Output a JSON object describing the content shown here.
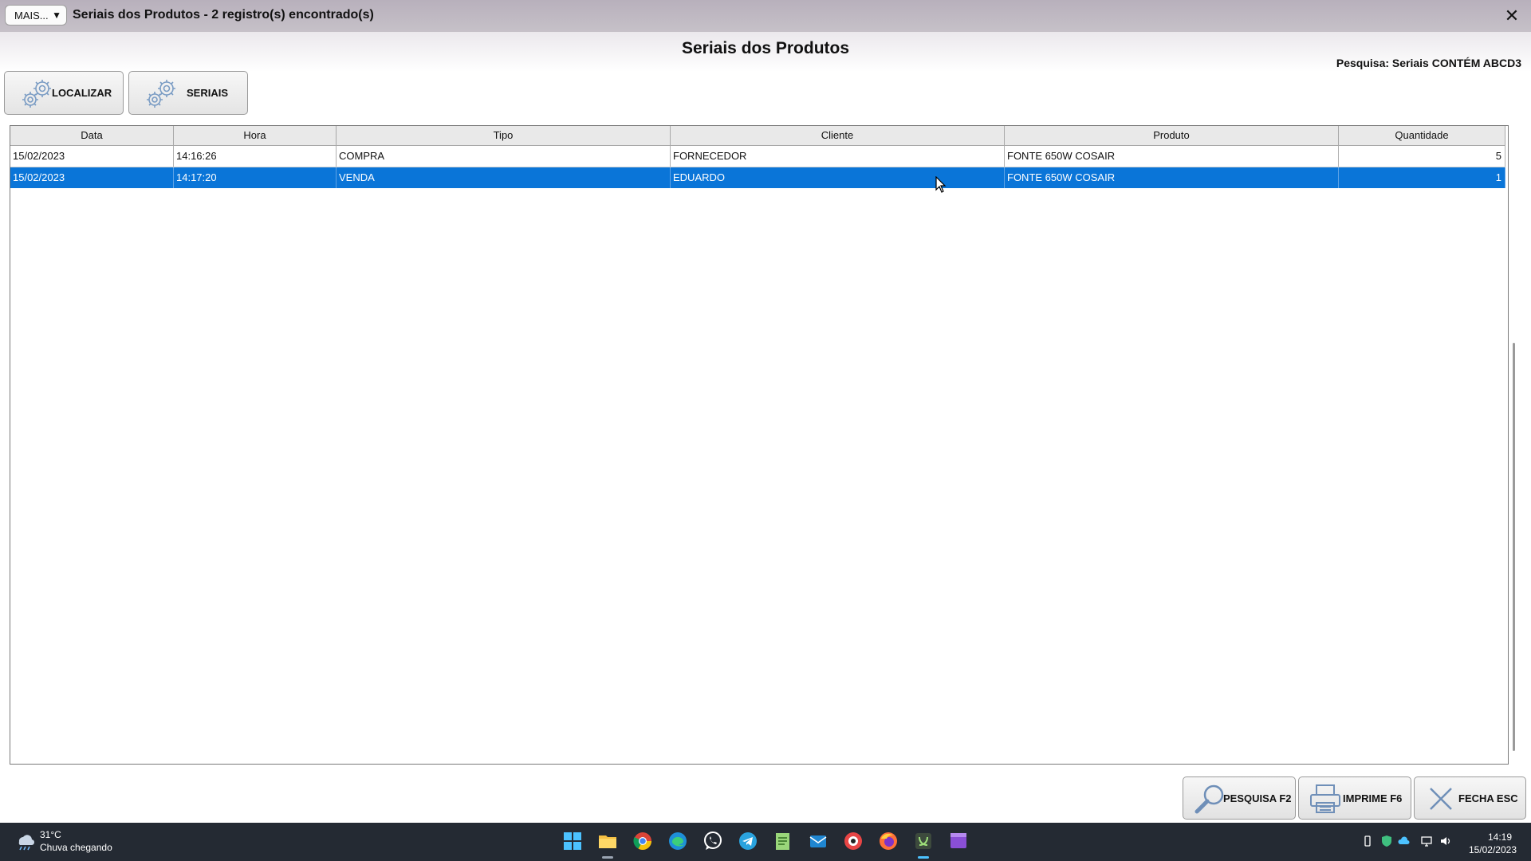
{
  "titlebar": {
    "menu_button": "MAIS...",
    "menu_arrow": "▼",
    "title": "Seriais dos Produtos - 2 registro(s) encontrado(s)",
    "close": "✕"
  },
  "header": {
    "title": "Seriais dos Produtos",
    "search_info": "Pesquisa: Seriais CONTÉM ABCD3"
  },
  "toolbar": {
    "localizar_label": "LOCALIZAR",
    "seriais_label": "SERIAIS"
  },
  "grid": {
    "columns": [
      "Data",
      "Hora",
      "Tipo",
      "Cliente",
      "Produto",
      "Quantidade"
    ],
    "rows": [
      {
        "data": "15/02/2023",
        "hora": "14:16:26",
        "tipo": "COMPRA",
        "cliente": "FORNECEDOR",
        "produto": "FONTE 650W COSAIR",
        "quantidade": "5",
        "selected": false
      },
      {
        "data": "15/02/2023",
        "hora": "14:17:20",
        "tipo": "VENDA",
        "cliente": "EDUARDO",
        "produto": "FONTE 650W COSAIR",
        "quantidade": "1",
        "selected": true
      }
    ],
    "selection_color": "#0a75d8"
  },
  "actions": {
    "pesquisa_label": "PESQUISA F2",
    "imprime_label": "IMPRIME F6",
    "fecha_label": "FECHA ESC"
  },
  "taskbar": {
    "weather_temp": "31°C",
    "weather_desc": "Chuva chegando",
    "apps": [
      "windows-start-icon",
      "file-explorer-icon",
      "chrome-icon",
      "edge-icon",
      "whatsapp-icon",
      "telegram-icon",
      "notepad-icon",
      "mail-icon",
      "app-icon",
      "firefox-icon",
      "erp-app-icon",
      "video-editor-icon"
    ],
    "clock_time": "14:19",
    "clock_date": "15/02/2023"
  }
}
